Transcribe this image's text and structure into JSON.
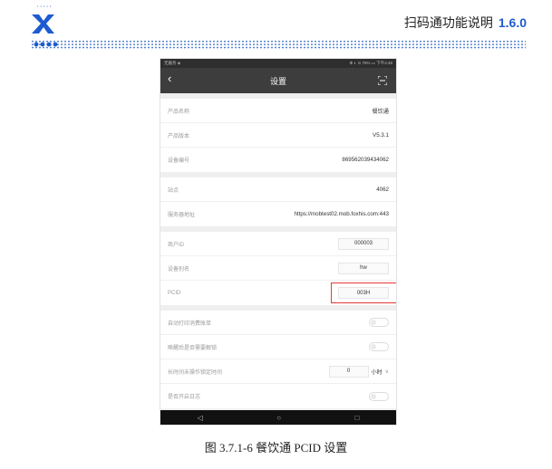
{
  "header": {
    "title": "扫码通功能说明",
    "version": "1.6.0"
  },
  "phone": {
    "statusbar": {
      "left": "无服务 ◈",
      "right": "✻ ◐ ⊙ 76% ▭ 下午4:48"
    },
    "appbar": {
      "title": "设置"
    },
    "section1": [
      {
        "label": "产品名称",
        "value": "餐饮通"
      },
      {
        "label": "产品版本",
        "value": "V5.3.1"
      },
      {
        "label": "设备编号",
        "value": "869562039434062"
      }
    ],
    "section2": [
      {
        "label": "站点",
        "value": "4062"
      },
      {
        "label": "服务器地址",
        "value": "https://mobtest02.mob.foxhis.com:443"
      }
    ],
    "section3": [
      {
        "label": "商户ID",
        "value": "000003"
      },
      {
        "label": "设备别名",
        "value": "hw"
      },
      {
        "label": "PCID",
        "value": "003H"
      }
    ],
    "section4": {
      "auto_print": {
        "label": "自动打印消费账单"
      },
      "wake_unlock": {
        "label": "唤醒后是否需要解锁"
      },
      "idle_lock": {
        "label": "长时间未操作锁定时间",
        "value": "0",
        "unit": "小时"
      },
      "log": {
        "label": "是否开启日志"
      }
    },
    "navbar": {
      "back": "◁",
      "home": "○",
      "recent": "□"
    }
  },
  "caption": "图 3.7.1-6  餐饮通 PCID 设置",
  "colors": {
    "accent": "#1e5bd0",
    "highlight": "#e53935",
    "appbar": "#3d3d3d"
  }
}
